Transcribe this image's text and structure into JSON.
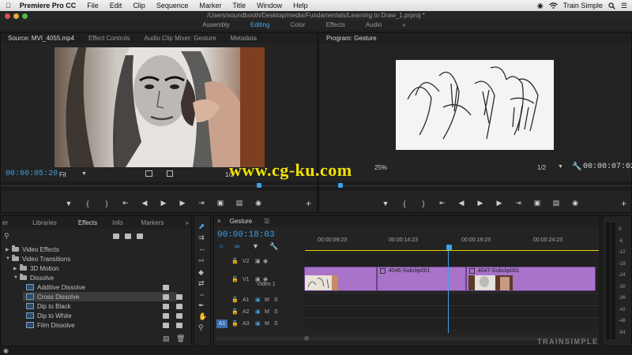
{
  "menubar": {
    "app_name": "Premiere Pro CC",
    "items": [
      "File",
      "Edit",
      "Clip",
      "Sequence",
      "Marker",
      "Title",
      "Window",
      "Help"
    ],
    "right_label": "Train Simple"
  },
  "title_path": "/Users/soundbooth/Desktop/media/Fundamentals/Learning to Draw_1.prproj *",
  "workspaces": [
    "Assembly",
    "Editing",
    "Color",
    "Effects",
    "Audio"
  ],
  "workspace_active": "Editing",
  "source": {
    "tabs": [
      "Source: MVI_4055.mp4",
      "Effect Controls",
      "Audio Clip Mixer: Gesture",
      "Metadata"
    ],
    "timecode": "00:00:05:20",
    "fit": "Fit",
    "fraction": "1/2"
  },
  "program": {
    "tab": "Program: Gesture",
    "zoom": "25%",
    "fraction": "1/2",
    "duration": "00:00:07:02"
  },
  "watermark": "www.cg-ku.com",
  "project": {
    "tabs": [
      "Libraries",
      "Effects",
      "Info",
      "Markers"
    ],
    "active_tab": "Effects",
    "tree": [
      {
        "label": "Video Effects",
        "type": "folder",
        "level": 0,
        "expanded": false
      },
      {
        "label": "Video Transitions",
        "type": "folder",
        "level": 0,
        "expanded": true
      },
      {
        "label": "3D Motion",
        "type": "folder",
        "level": 1,
        "expanded": false
      },
      {
        "label": "Dissolve",
        "type": "folder",
        "level": 1,
        "expanded": true
      },
      {
        "label": "Additive Dissolve",
        "type": "effect",
        "level": 2
      },
      {
        "label": "Cross Dissolve",
        "type": "effect",
        "level": 2,
        "selected": true
      },
      {
        "label": "Dip to Black",
        "type": "effect",
        "level": 2
      },
      {
        "label": "Dip to White",
        "type": "effect",
        "level": 2
      },
      {
        "label": "Film Dissolve",
        "type": "effect",
        "level": 2
      }
    ]
  },
  "timeline": {
    "tab": "Gesture",
    "timecode": "00:00:18:03",
    "ruler": [
      "00:00:09:23",
      "00:00:14:23",
      "00:00:19:23",
      "00:00:24:23"
    ],
    "tracks": [
      {
        "name": "V2",
        "label": ""
      },
      {
        "name": "V1",
        "label": "Video 1"
      },
      {
        "name": "A1",
        "label": ""
      },
      {
        "name": "A2",
        "label": ""
      },
      {
        "name": "A3",
        "label": ""
      }
    ],
    "source_patch": "A1",
    "mute_label": "M",
    "solo_label": "S",
    "clips": [
      "4046-Subclip001",
      "4047-Subclip001"
    ]
  },
  "meter_ticks": [
    "0",
    "-6",
    "-12",
    "-18",
    "-24",
    "-30",
    "-36",
    "-42",
    "-48",
    "-54"
  ],
  "brand": "TRAINSIMPLE",
  "colors": {
    "accent": "#3fa0e8",
    "clip": "#a873c9",
    "watermark": "#f2e200"
  }
}
